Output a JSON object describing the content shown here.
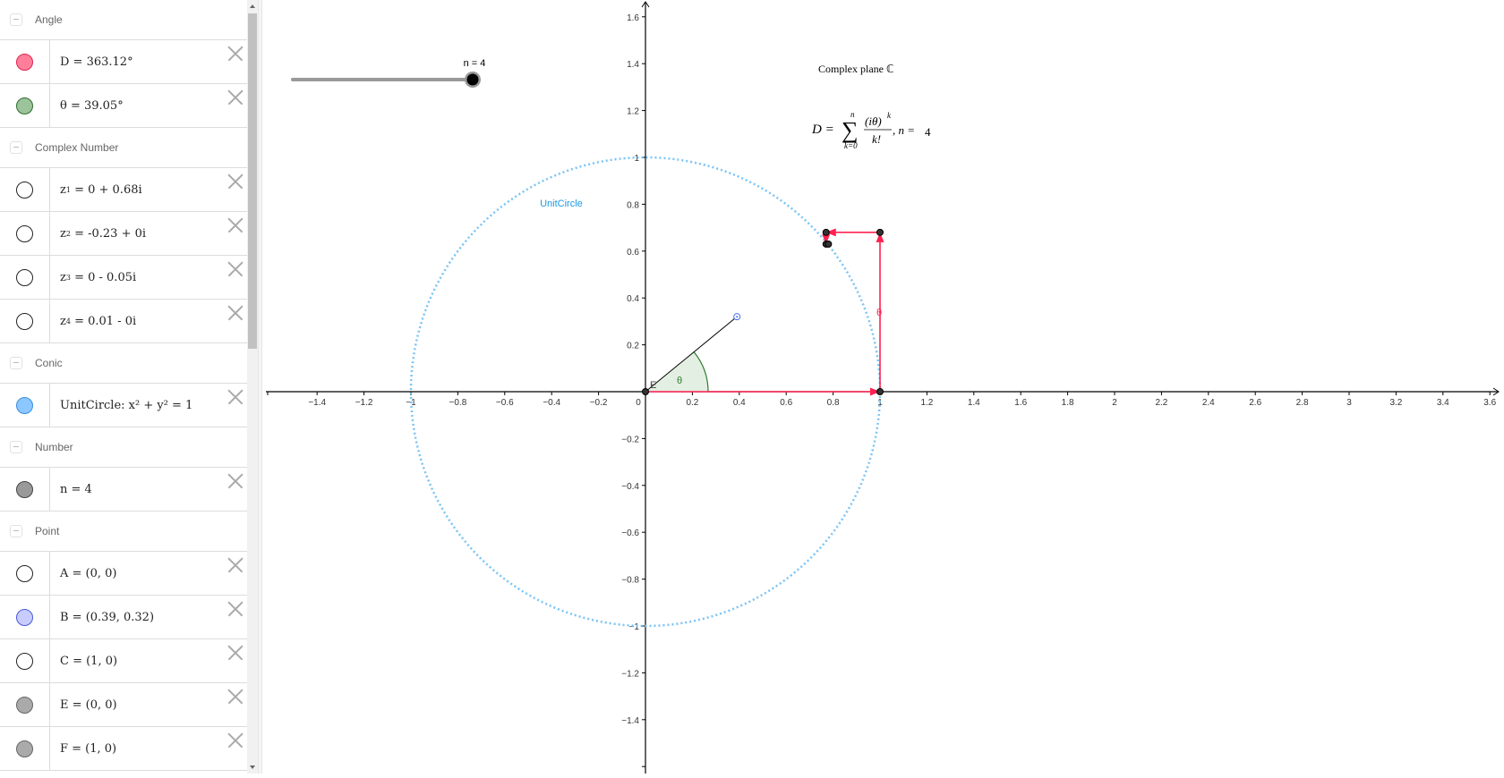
{
  "algebra": {
    "groups": [
      {
        "label": "Angle",
        "items": [
          {
            "name": "D",
            "html": "D = 363.12°",
            "marble": {
              "fill": "#ff7f9a",
              "stroke": "#e0224f"
            }
          },
          {
            "name": "theta",
            "html": "θ = 39.05°",
            "marble": {
              "fill": "#9bc49b",
              "stroke": "#2e6b2e"
            }
          }
        ]
      },
      {
        "label": "Complex Number",
        "items": [
          {
            "name": "z1",
            "var": "z",
            "sub": "1",
            "rest": " = 0 + 0.68i",
            "marble": {
              "fill": "#ffffff",
              "stroke": "#222222"
            }
          },
          {
            "name": "z2",
            "var": "z",
            "sub": "2",
            "rest": " = -0.23 + 0i",
            "marble": {
              "fill": "#ffffff",
              "stroke": "#222222"
            }
          },
          {
            "name": "z3",
            "var": "z",
            "sub": "3",
            "rest": " = 0 - 0.05i",
            "marble": {
              "fill": "#ffffff",
              "stroke": "#222222"
            }
          },
          {
            "name": "z4",
            "var": "z",
            "sub": "4",
            "rest": " = 0.01 - 0i",
            "marble": {
              "fill": "#ffffff",
              "stroke": "#222222"
            }
          }
        ]
      },
      {
        "label": "Conic",
        "items": [
          {
            "name": "unitcircle",
            "html": "UnitCircle: x² + y² = 1",
            "marble": {
              "fill": "#8cc8ff",
              "stroke": "#3a8ee0"
            }
          }
        ]
      },
      {
        "label": "Number",
        "items": [
          {
            "name": "n",
            "html": "n = 4",
            "marble": {
              "fill": "#999999",
              "stroke": "#444444"
            }
          }
        ]
      },
      {
        "label": "Point",
        "items": [
          {
            "name": "A",
            "html": "A = (0, 0)",
            "marble": {
              "fill": "#ffffff",
              "stroke": "#222222"
            }
          },
          {
            "name": "B",
            "html": "B = (0.39, 0.32)",
            "marble": {
              "fill": "#c8ccff",
              "stroke": "#4a5ad8"
            }
          },
          {
            "name": "C",
            "html": "C = (1, 0)",
            "marble": {
              "fill": "#ffffff",
              "stroke": "#222222"
            }
          },
          {
            "name": "E",
            "html": "E = (0, 0)",
            "marble": {
              "fill": "#aaaaaa",
              "stroke": "#666666"
            }
          },
          {
            "name": "F",
            "html": "F = (1, 0)",
            "marble": {
              "fill": "#aaaaaa",
              "stroke": "#666666"
            }
          }
        ]
      }
    ]
  },
  "graphics": {
    "slider": {
      "label": "n = 4",
      "value": 4,
      "min": 0,
      "max": 4
    },
    "title_text": "Complex plane ℂ",
    "formula": {
      "lhs": "D = ",
      "sum_top": "n",
      "sum_bottom": "k=0",
      "numerator": "(iθ)",
      "num_exp": "k",
      "denominator": "k!",
      "suffix": ", n = ",
      "n_value": "4"
    },
    "unit_circle_label": "UnitCircle",
    "angle_label": "θ",
    "point_label_E": "E",
    "vector_label": "θ",
    "colors": {
      "unit_circle": "#79c4f5",
      "vector": "#ff2050",
      "angle": "#2e7d2e",
      "angle_fill": "#e3efe3",
      "axis": "#000000",
      "point": "#333333",
      "point_B": "#4a6ee0"
    },
    "x_axis": {
      "min": -1.4,
      "max": 3.6,
      "step": 0.2
    },
    "y_axis": {
      "min": -1.4,
      "max": 1.6,
      "step": 0.2
    },
    "points": {
      "origin": [
        0,
        0
      ],
      "B": [
        0.39,
        0.32
      ],
      "C": [
        1,
        0
      ],
      "p1": [
        1,
        0.68
      ],
      "p2": [
        0.77,
        0.68
      ],
      "p3": [
        0.77,
        0.63
      ],
      "p4": [
        0.78,
        0.63
      ]
    },
    "theta_deg": 39.05
  }
}
